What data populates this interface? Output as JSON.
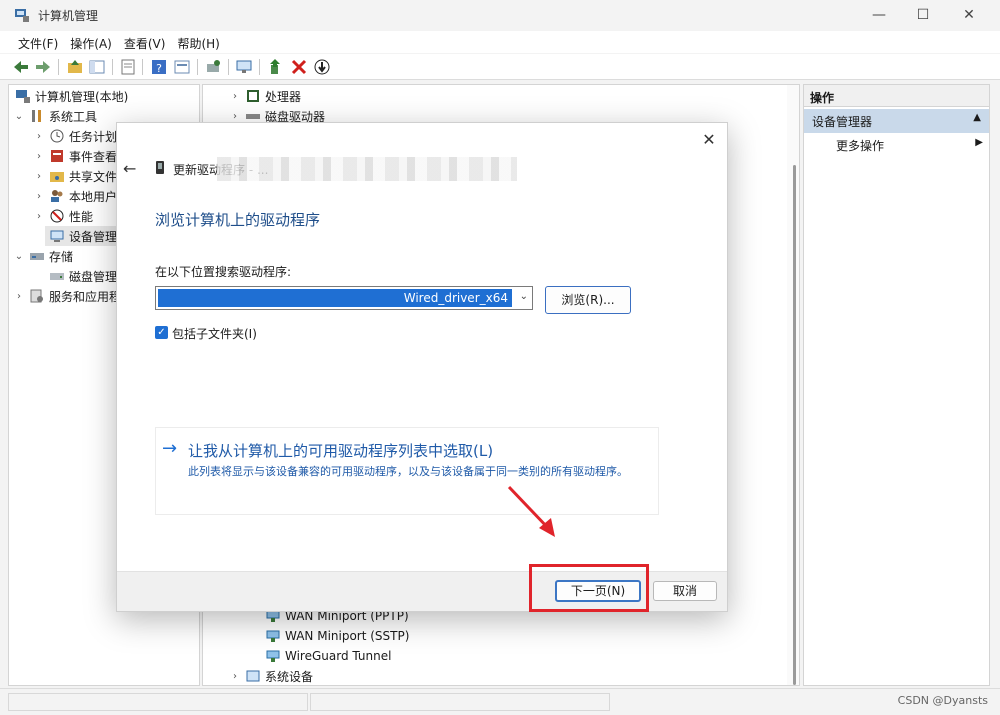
{
  "window": {
    "title": "计算机管理"
  },
  "menu": [
    "文件(F)",
    "操作(A)",
    "查看(V)",
    "帮助(H)"
  ],
  "tree": {
    "root": "计算机管理(本地)",
    "system_tools": "系统工具",
    "items": [
      "任务计划",
      "事件查看",
      "共享文件",
      "本地用户",
      "性能",
      "设备管理"
    ],
    "storage": "存储",
    "disk_mgmt": "磁盘管理",
    "services": "服务和应用程"
  },
  "device_list": {
    "top": [
      "处理器",
      "磁盘驱动器"
    ],
    "bottom": [
      "WAN Miniport (PPTP)",
      "WAN Miniport (SSTP)",
      "WireGuard Tunnel"
    ],
    "last": "系统设备"
  },
  "actions": {
    "header": "操作",
    "section": "设备管理器",
    "more": "更多操作"
  },
  "dialog": {
    "title": "更新驱动程序 - ...",
    "heading": "浏览计算机上的驱动程序",
    "search_label": "在以下位置搜索驱动程序:",
    "path_value": "Wired_driver_x64",
    "browse_label": "浏览(R)...",
    "include_subfolders": "包括子文件夹(I)",
    "pick_title": "让我从计算机上的可用驱动程序列表中选取(L)",
    "pick_desc": "此列表将显示与该设备兼容的可用驱动程序，以及与该设备属于同一类别的所有驱动程序。",
    "next_label": "下一页(N)",
    "cancel_label": "取消"
  },
  "watermark": "CSDN @Dyansts",
  "colors": {
    "accent": "#1f6fd3",
    "link": "#1f5aa8",
    "highlight": "#e0242b",
    "action_band": "#c9d9ea"
  }
}
